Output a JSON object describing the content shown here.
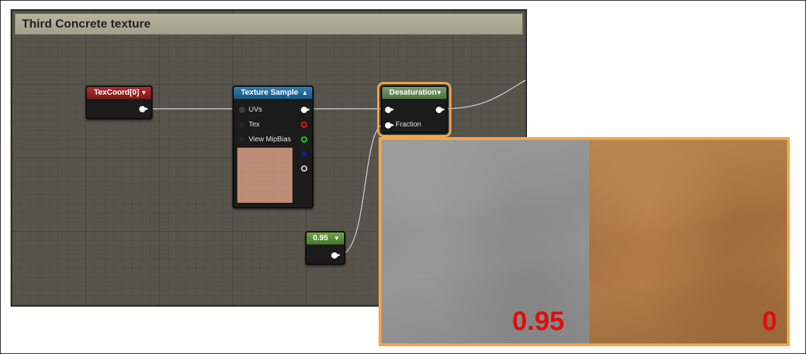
{
  "graph": {
    "title": "Third Concrete texture"
  },
  "nodes": {
    "texcoord": {
      "title": "TexCoord[0]",
      "color": "#8e2020"
    },
    "texture_sample": {
      "title": "Texture Sample",
      "color": "#1f5f8a",
      "inputs": [
        "UVs",
        "Tex",
        "View MipBias"
      ]
    },
    "desaturation": {
      "title": "Desaturation",
      "color": "#5a7e4c",
      "inputs": [
        "Fraction"
      ]
    },
    "constant": {
      "title": "0.95",
      "color": "#5a8e3a"
    }
  },
  "comparison": {
    "left_value": "0.95",
    "right_value": "0",
    "border_color": "#f3a54b",
    "label_color": "#e00d0d"
  }
}
